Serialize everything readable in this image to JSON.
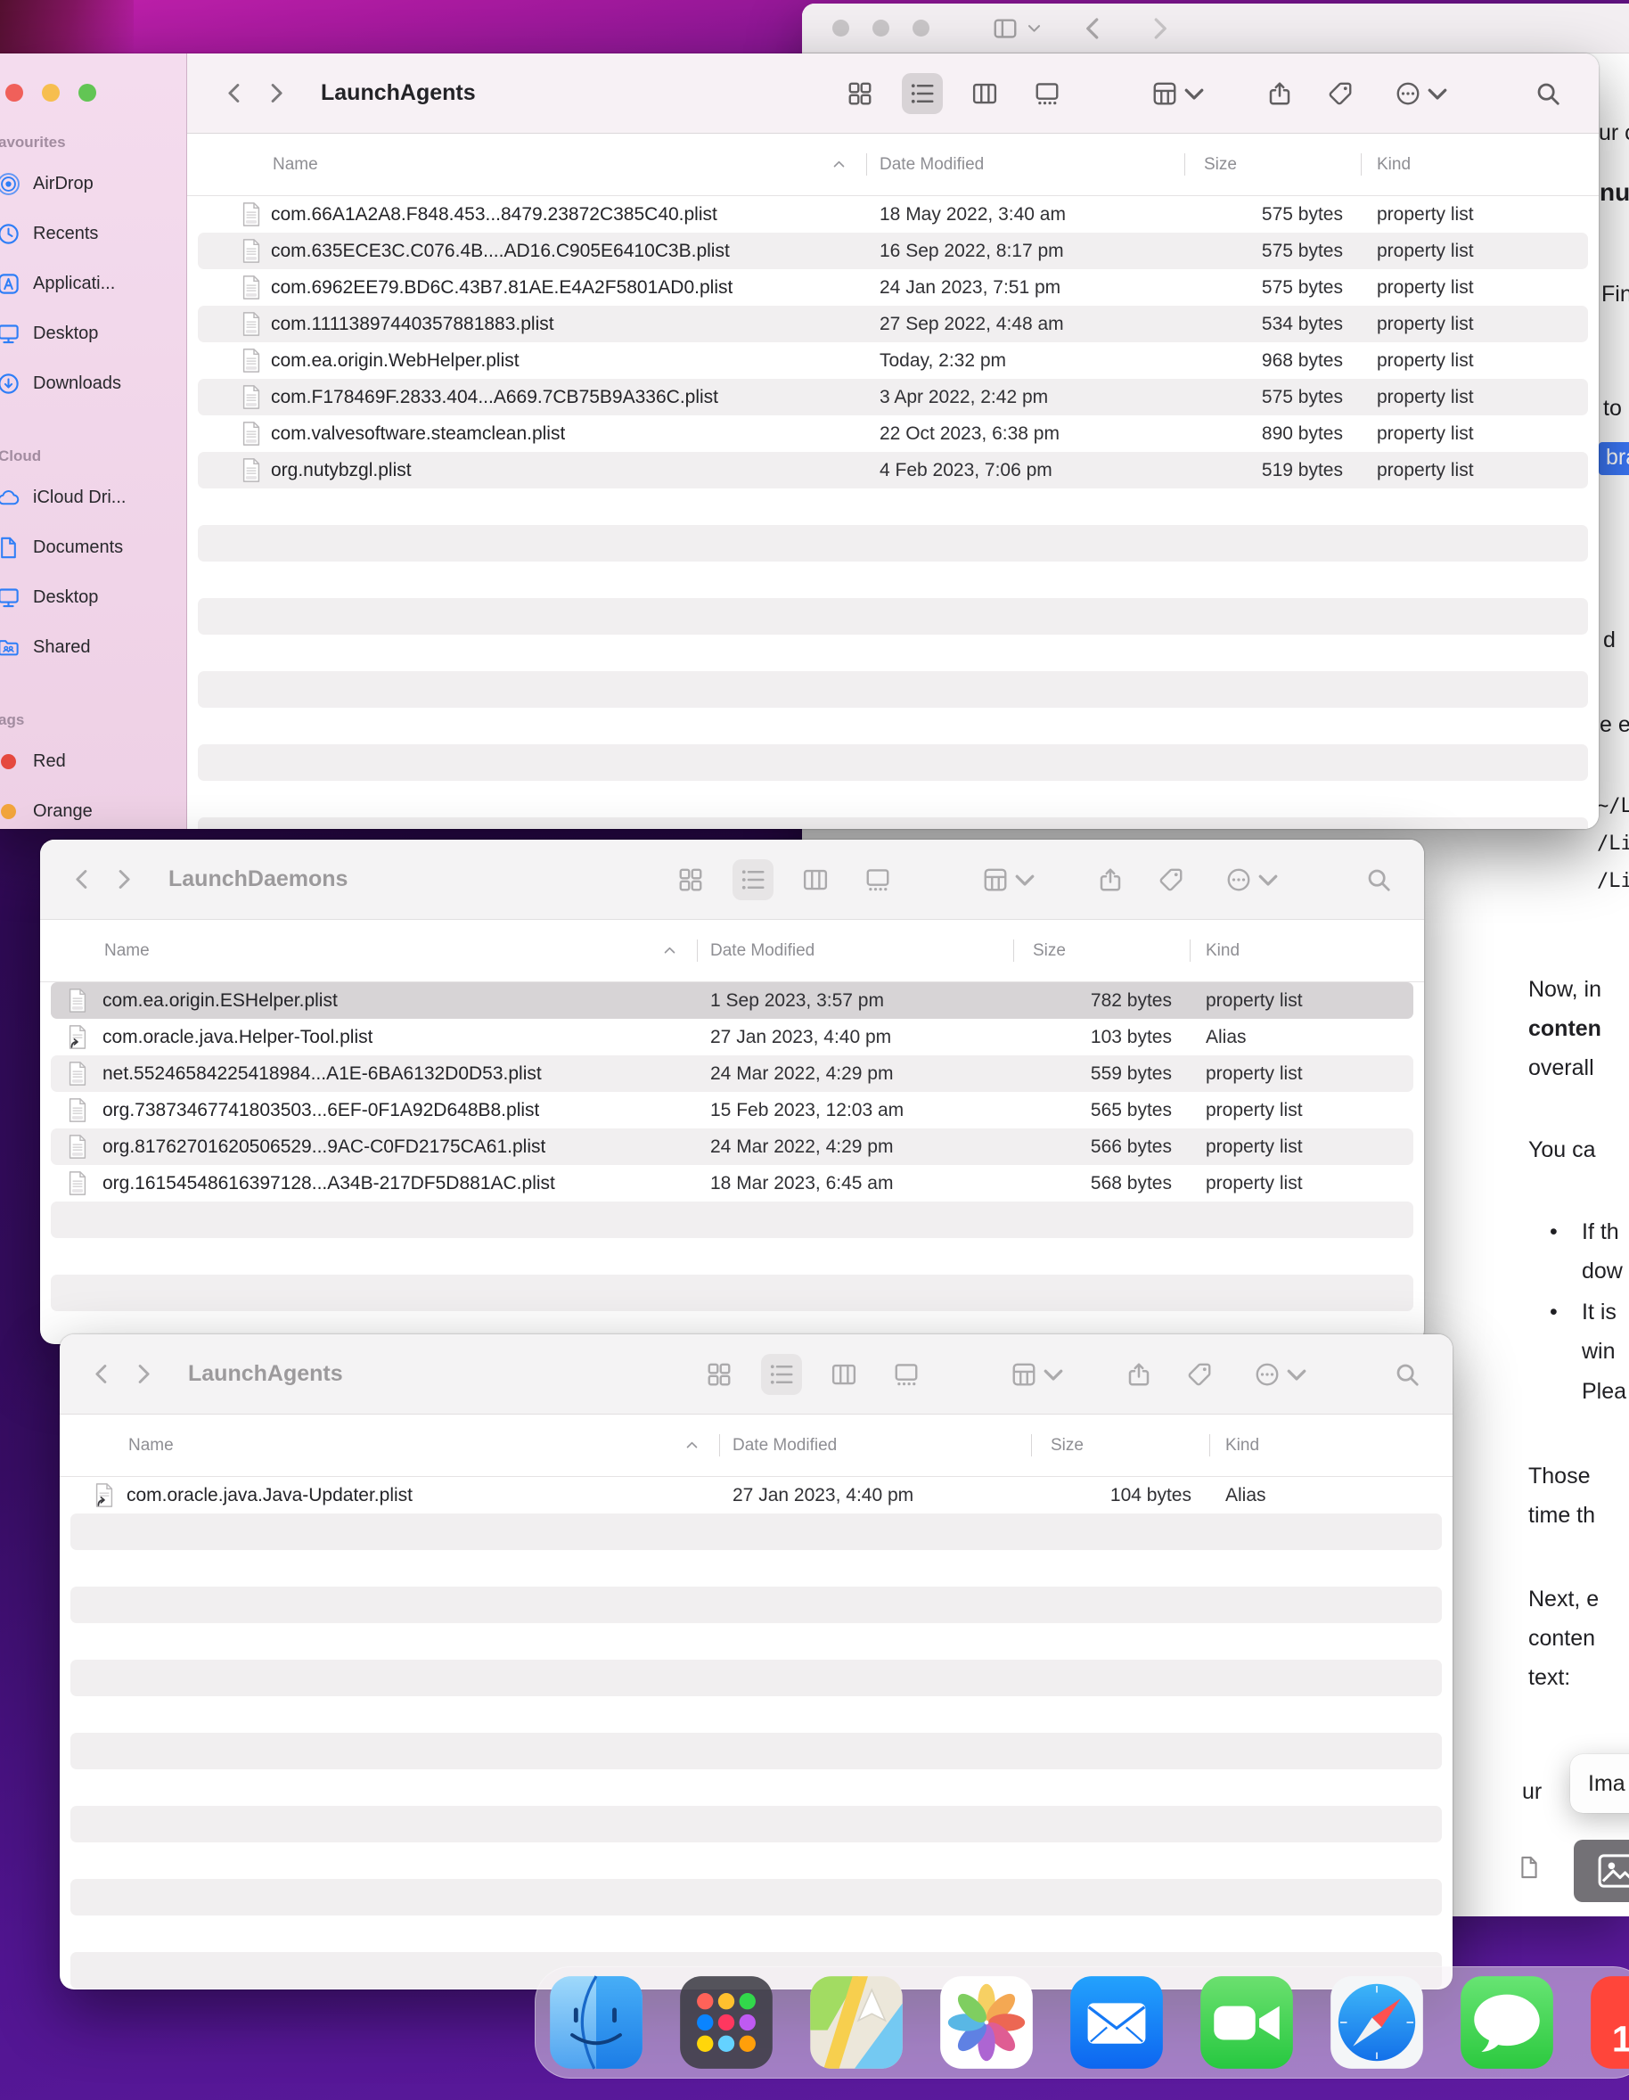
{
  "colors": {
    "selection_blue": "#3b77f7",
    "sidebar_icon_blue": "#2e7ef7",
    "tag_red": "#e5493f",
    "tag_orange": "#f1a43c",
    "desktop_magenta": "#c121ab",
    "desktop_purple": "#511591"
  },
  "finder_sidebar": {
    "sections": [
      {
        "title": "avourites",
        "items": [
          {
            "label": "AirDrop",
            "icon": "airdrop-icon"
          },
          {
            "label": "Recents",
            "icon": "recents-icon"
          },
          {
            "label": "Applicati...",
            "icon": "applications-icon"
          },
          {
            "label": "Desktop",
            "icon": "desktop-icon"
          },
          {
            "label": "Downloads",
            "icon": "downloads-icon"
          }
        ]
      },
      {
        "title": "Cloud",
        "items": [
          {
            "label": "iCloud Dri...",
            "icon": "icloud-icon"
          },
          {
            "label": "Documents",
            "icon": "documents-icon"
          },
          {
            "label": "Desktop",
            "icon": "desktop-icon"
          },
          {
            "label": "Shared",
            "icon": "shared-folder-icon"
          }
        ]
      },
      {
        "title": "ags",
        "items": [
          {
            "label": "Red",
            "icon": "red-tag-icon",
            "color": "#e5493f"
          },
          {
            "label": "Orange",
            "icon": "orange-tag-icon",
            "color": "#f1a43c"
          }
        ]
      }
    ]
  },
  "windows": {
    "top": {
      "title": "LaunchAgents",
      "columns": {
        "name": "Name",
        "date": "Date Modified",
        "size": "Size",
        "kind": "Kind"
      },
      "rows": [
        {
          "name": "com.66A1A2A8.F848.453...8479.23872C385C40.plist",
          "date": "18 May 2022, 3:40 am",
          "size": "575 bytes",
          "kind": "property list"
        },
        {
          "name": "com.635ECE3C.C076.4B....AD16.C905E6410C3B.plist",
          "date": "16 Sep 2022, 8:17 pm",
          "size": "575 bytes",
          "kind": "property list"
        },
        {
          "name": "com.6962EE79.BD6C.43B7.81AE.E4A2F5801AD0.plist",
          "date": "24 Jan 2023, 7:51 pm",
          "size": "575 bytes",
          "kind": "property list"
        },
        {
          "name": "com.11113897440357881883.plist",
          "date": "27 Sep 2022, 4:48 am",
          "size": "534 bytes",
          "kind": "property list"
        },
        {
          "name": "com.ea.origin.WebHelper.plist",
          "date": "Today, 2:32 pm",
          "size": "968 bytes",
          "kind": "property list"
        },
        {
          "name": "com.F178469F.2833.404...A669.7CB75B9A336C.plist",
          "date": "3 Apr 2022, 2:42 pm",
          "size": "575 bytes",
          "kind": "property list"
        },
        {
          "name": "com.valvesoftware.steamclean.plist",
          "date": "22 Oct 2023, 6:38 pm",
          "size": "890 bytes",
          "kind": "property list"
        },
        {
          "name": "org.nutybzgl.plist",
          "date": "4 Feb 2023, 7:06 pm",
          "size": "519 bytes",
          "kind": "property list"
        }
      ]
    },
    "middle": {
      "title": "LaunchDaemons",
      "columns": {
        "name": "Name",
        "date": "Date Modified",
        "size": "Size",
        "kind": "Kind"
      },
      "rows": [
        {
          "name": "com.ea.origin.ESHelper.plist",
          "date": "1 Sep 2023, 3:57 pm",
          "size": "782 bytes",
          "kind": "property list",
          "selected": true
        },
        {
          "name": "com.oracle.java.Helper-Tool.plist",
          "date": "27 Jan 2023, 4:40 pm",
          "size": "103 bytes",
          "kind": "Alias"
        },
        {
          "name": "net.55246584225418984...A1E-6BA6132D0D53.plist",
          "date": "24 Mar 2022, 4:29 pm",
          "size": "559 bytes",
          "kind": "property list"
        },
        {
          "name": "org.73873467741803503...6EF-0F1A92D648B8.plist",
          "date": "15 Feb 2023, 12:03 am",
          "size": "565 bytes",
          "kind": "property list"
        },
        {
          "name": "org.81762701620506529...9AC-C0FD2175CA61.plist",
          "date": "24 Mar 2022, 4:29 pm",
          "size": "566 bytes",
          "kind": "property list"
        },
        {
          "name": "org.16154548616397128...A34B-217DF5D881AC.plist",
          "date": "18 Mar 2023, 6:45 am",
          "size": "568 bytes",
          "kind": "property list"
        }
      ]
    },
    "bottom": {
      "title": "LaunchAgents",
      "columns": {
        "name": "Name",
        "date": "Date Modified",
        "size": "Size",
        "kind": "Kind"
      },
      "rows": [
        {
          "name": "com.oracle.java.Java-Updater.plist",
          "date": "27 Jan 2023, 4:40 pm",
          "size": "104 bytes",
          "kind": "Alias"
        }
      ]
    }
  },
  "safari": {
    "edge_lines": [
      {
        "text": "ur c"
      },
      {
        "text": "nu"
      },
      {
        "text": "Fin"
      },
      {
        "text": "to"
      },
      {
        "text": "bra"
      },
      {
        "text": "d"
      },
      {
        "text": "e e"
      },
      {
        "text": "~/L"
      },
      {
        "text": "/Lib"
      },
      {
        "text": "/Lib"
      }
    ],
    "article_lines": [
      {
        "text": "Now, in"
      },
      {
        "text": "conten"
      },
      {
        "text": "overall"
      },
      {
        "text": "You ca"
      },
      {
        "text": "If th"
      },
      {
        "text": "dow"
      },
      {
        "text": "It is"
      },
      {
        "text": "win"
      },
      {
        "text": "Plea"
      },
      {
        "text": "Those"
      },
      {
        "text": "time th"
      },
      {
        "text": "Next, e"
      },
      {
        "text": "conten"
      },
      {
        "text": "text:"
      },
      {
        "text": "ur"
      }
    ],
    "popup_label": "Ima"
  },
  "dock": {
    "apps": [
      "Finder",
      "Launchpad",
      "Maps",
      "Photos",
      "Mail",
      "FaceTime",
      "Safari",
      "Messages"
    ],
    "partial_label": "1"
  }
}
